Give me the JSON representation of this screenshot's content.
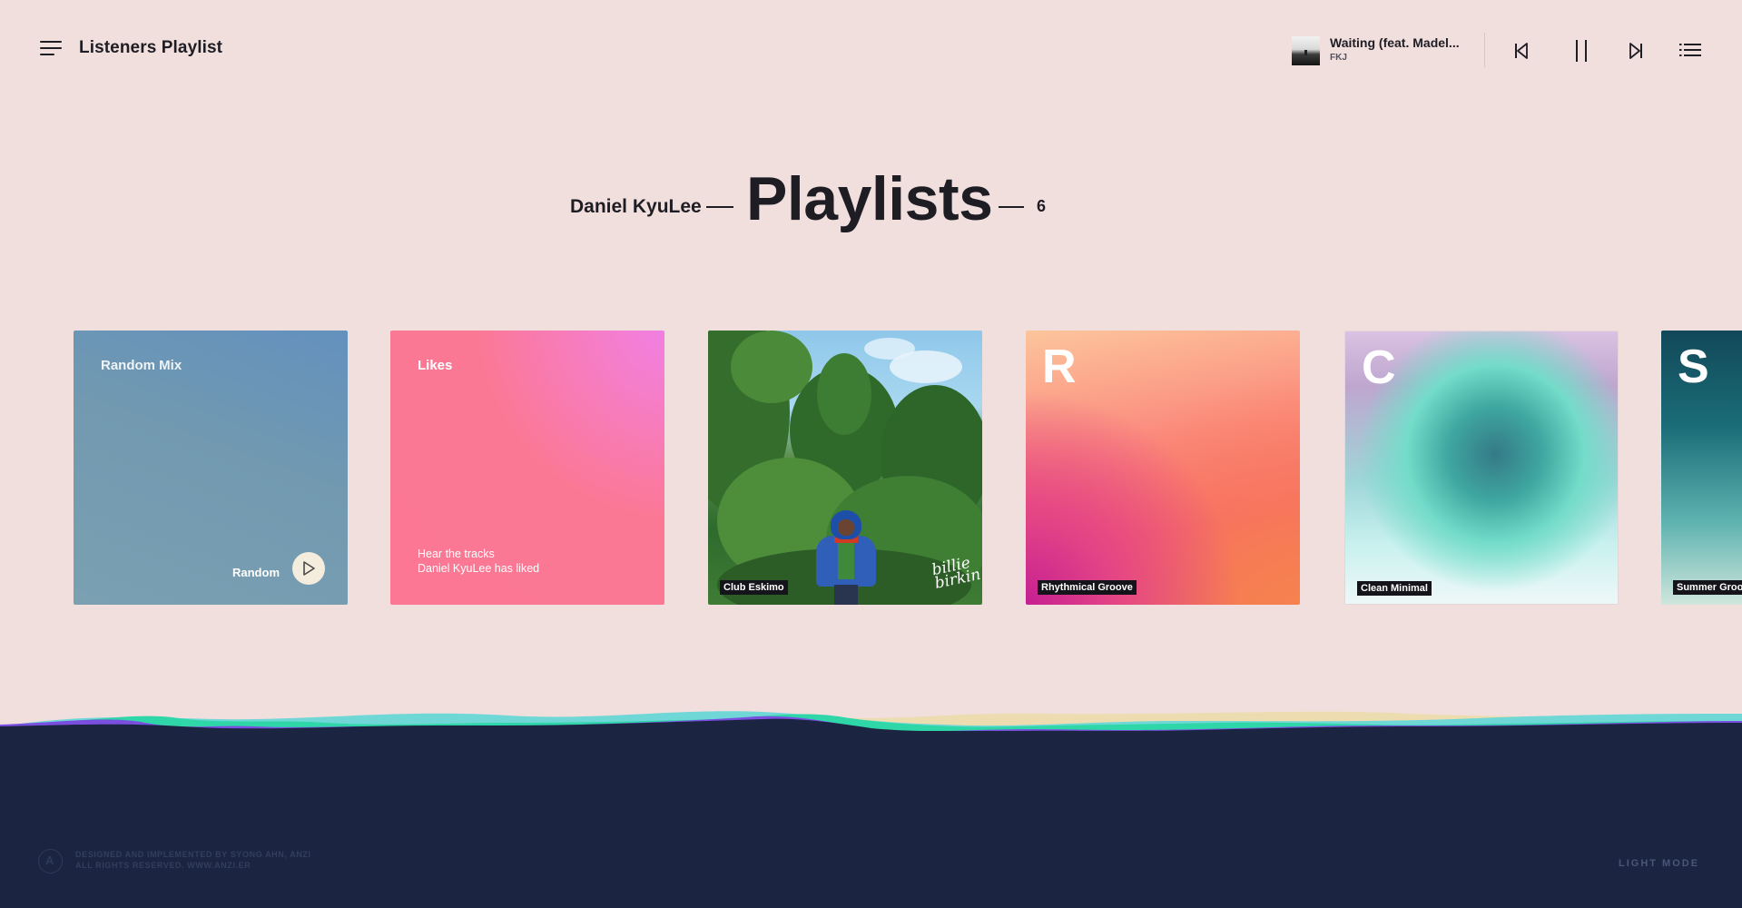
{
  "header": {
    "app_title": "Listeners Playlist",
    "menu_icon": "hamburger-icon"
  },
  "now_playing": {
    "title": "Waiting (feat. Madel...",
    "artist": "FKJ"
  },
  "controls": {
    "prev_icon": "skip-previous-icon",
    "pause_icon": "pause-icon",
    "next_icon": "skip-next-icon",
    "queue_icon": "queue-list-icon"
  },
  "headline": {
    "user": "Daniel KyuLee",
    "title": "Playlists",
    "count": "6"
  },
  "cards": [
    {
      "title": "Random Mix",
      "action_label": "Random",
      "action_icon": "play-icon"
    },
    {
      "title": "Likes",
      "description_line1": "Hear the tracks",
      "description_line2": "Daniel KyuLee has liked"
    },
    {
      "tag": "Club Eskimo",
      "signature_line1": "billie",
      "signature_line2": "birkin"
    },
    {
      "letter": "R",
      "tag": "Rhythmical Groove"
    },
    {
      "letter": "C",
      "tag": "Clean Minimal"
    },
    {
      "letter": "S",
      "tag": "Summer Groove"
    }
  ],
  "footer": {
    "credits_line1": "DESIGNED AND IMPLEMENTED BY SYONG AHN, ANZI",
    "credits_line2": "ALL RIGHTS RESERVED. WWW.ANZI.ER",
    "logo_letter": "A",
    "mode_toggle": "LIGHT MODE"
  },
  "colors": {
    "background": "#f1dfde",
    "footer_bg": "#1b2541",
    "text": "#1f1d24",
    "wave_purple": "#7a4fe0",
    "wave_teal": "#2fd6a8",
    "wave_cyan": "#6fd8d6",
    "wave_sand": "#eddcb0"
  }
}
